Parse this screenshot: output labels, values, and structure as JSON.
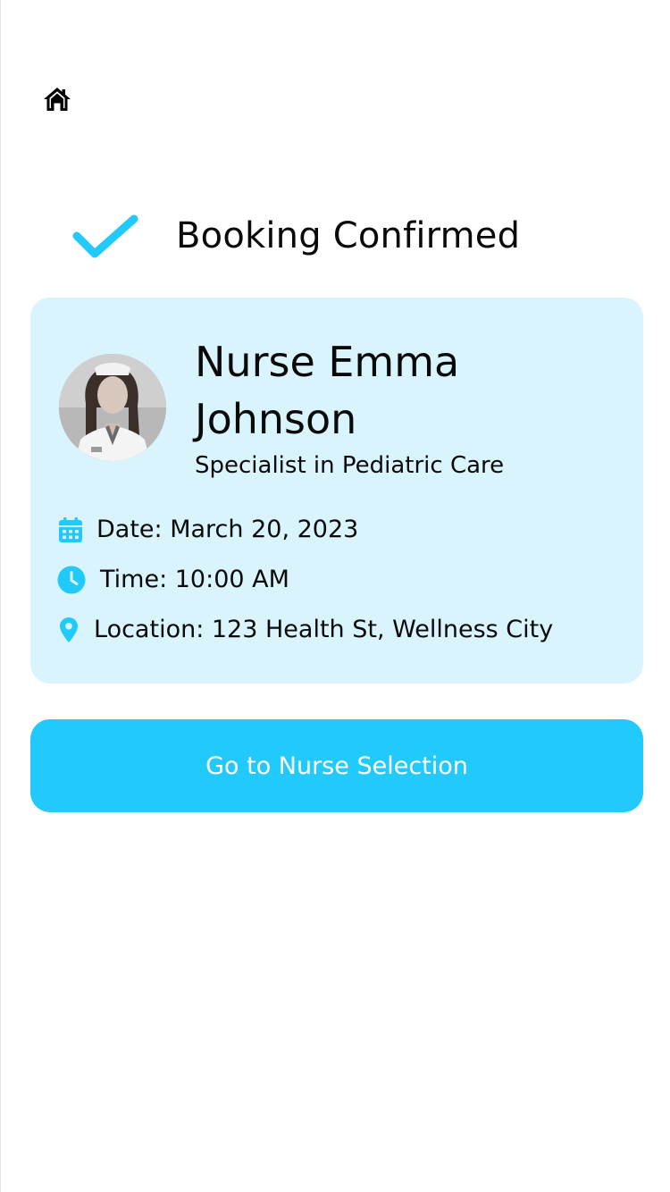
{
  "colors": {
    "accent": "#22c9fb",
    "card_background": "#d9f4fc",
    "text": "#0a0a0a",
    "button_text": "#ffffff"
  },
  "header": {
    "home_icon": "home-icon"
  },
  "confirmation": {
    "icon": "checkmark-icon",
    "title": "Booking Confirmed"
  },
  "nurse": {
    "avatar_icon": "nurse-photo",
    "name": "Nurse Emma Johnson",
    "specialty": "Specialist in Pediatric Care"
  },
  "details": {
    "date": {
      "icon": "calendar-icon",
      "text": "Date: March 20, 2023"
    },
    "time": {
      "icon": "clock-icon",
      "text": "Time: 10:00 AM"
    },
    "location": {
      "icon": "location-pin-icon",
      "text": "Location: 123 Health St, Wellness City"
    }
  },
  "actions": {
    "primary_label": "Go to Nurse Selection"
  }
}
